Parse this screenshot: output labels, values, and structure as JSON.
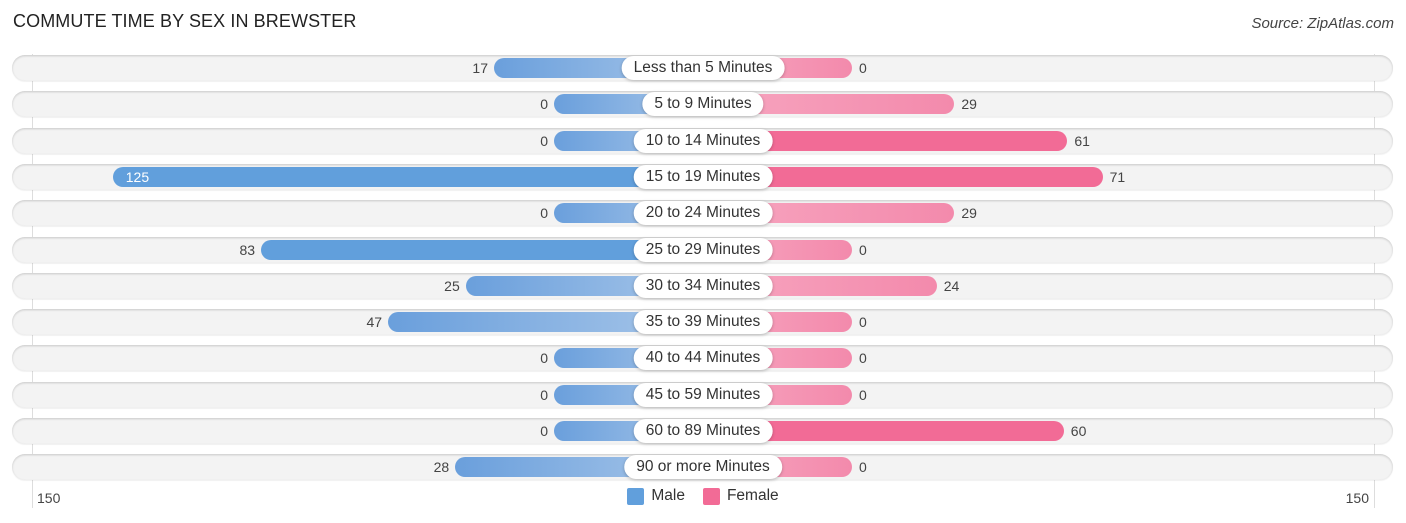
{
  "header": {
    "title": "COMMUTE TIME BY SEX IN BREWSTER",
    "source": "Source: ZipAtlas.com"
  },
  "colors": {
    "male": "#619fdc",
    "female": "#f26b96"
  },
  "chart_data": {
    "type": "bar",
    "orientation": "horizontal-diverging",
    "title": "COMMUTE TIME BY SEX IN BREWSTER",
    "categories": [
      "Less than 5 Minutes",
      "5 to 9 Minutes",
      "10 to 14 Minutes",
      "15 to 19 Minutes",
      "20 to 24 Minutes",
      "25 to 29 Minutes",
      "30 to 34 Minutes",
      "35 to 39 Minutes",
      "40 to 44 Minutes",
      "45 to 59 Minutes",
      "60 to 89 Minutes",
      "90 or more Minutes"
    ],
    "series": [
      {
        "name": "Male",
        "side": "left",
        "values": [
          17,
          0,
          0,
          125,
          0,
          83,
          25,
          47,
          0,
          0,
          0,
          28
        ]
      },
      {
        "name": "Female",
        "side": "right",
        "values": [
          0,
          29,
          61,
          71,
          29,
          0,
          24,
          0,
          0,
          0,
          60,
          0
        ]
      }
    ],
    "axis": {
      "left_label": "150",
      "right_label": "150",
      "max": 150
    },
    "legend": {
      "position": "bottom-center",
      "entries": [
        "Male",
        "Female"
      ]
    },
    "xlabel": "",
    "ylabel": ""
  }
}
